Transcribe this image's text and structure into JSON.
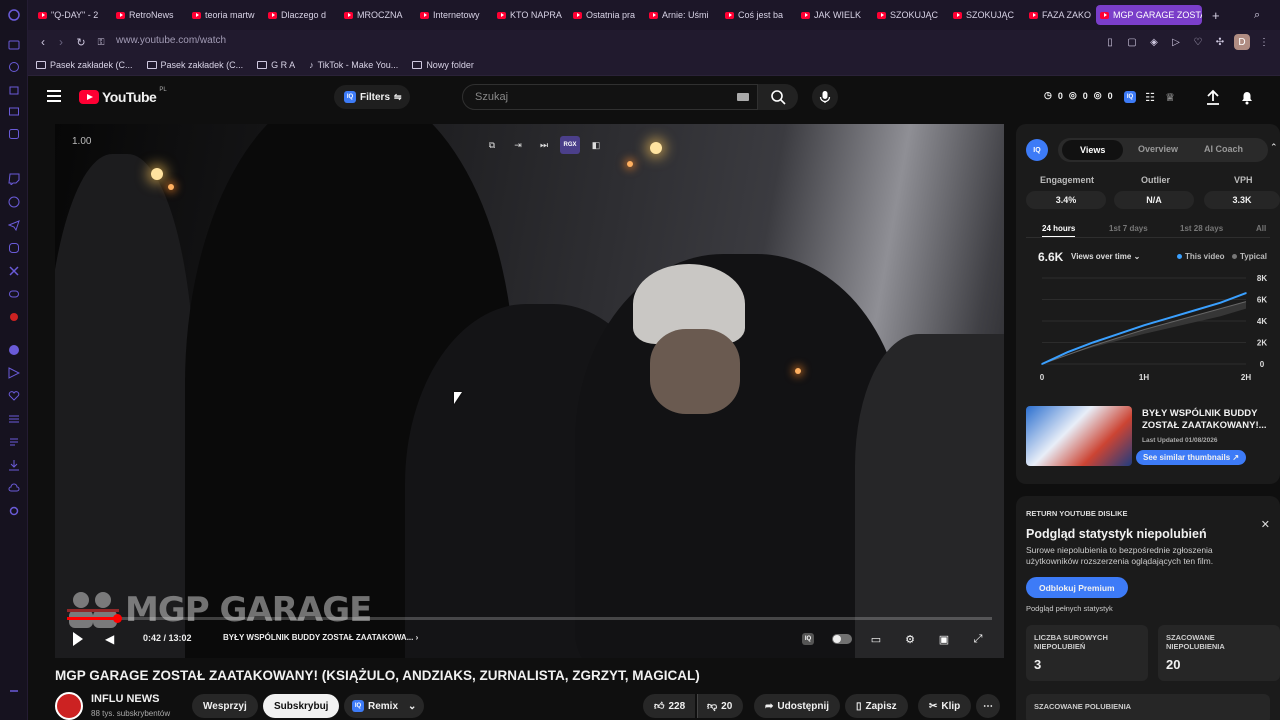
{
  "browser": {
    "tabs": [
      {
        "label": "\"Q-DAY\" - 2"
      },
      {
        "label": "RetroNews"
      },
      {
        "label": "teoria martw"
      },
      {
        "label": "Dlaczego d"
      },
      {
        "label": "MROCZNA"
      },
      {
        "label": "Internetowy"
      },
      {
        "label": "KTO NAPRA"
      },
      {
        "label": "Ostatnia pra"
      },
      {
        "label": "Arnie: Uśmi"
      },
      {
        "label": "Coś jest ba"
      },
      {
        "label": "JAK WIELK"
      },
      {
        "label": "SZOKUJĄC"
      },
      {
        "label": "SZOKUJĄC"
      },
      {
        "label": "FAZA ZAKO"
      },
      {
        "label": "MGP GARAGE ZOSTA"
      }
    ],
    "new_tab": "+",
    "url": "www.youtube.com/watch",
    "profile_initial": "D",
    "bookmarks": [
      {
        "label": "Pasek zakładek (C..."
      },
      {
        "label": "Pasek zakładek (C..."
      },
      {
        "label": "G R A"
      },
      {
        "label": "TikTok - Make You..."
      },
      {
        "label": "Nowy folder"
      }
    ]
  },
  "youtube": {
    "logo": "YouTube",
    "country": "PL",
    "filters_label": "Filters",
    "search_placeholder": "Szukaj",
    "header_stats": [
      "0",
      "0",
      "0"
    ]
  },
  "player": {
    "speed": "1.00",
    "rgx_label": "RGX",
    "watermark": "MGP GARAGE",
    "time": "0:42 / 13:02",
    "chapter": "BYŁY WSPÓLNIK BUDDY ZOSTAŁ ZAATAKOWA...",
    "progress_fraction": 0.054
  },
  "video": {
    "title": "MGP GARAGE ZOSTAŁ ZAATAKOWANY! (KSIĄŻULO, ANDZIAKS, ZURNALISTA, ZGRZYT, MAGICAL)",
    "channel": "INFLU NEWS",
    "subscribers": "88 tys. subskrybentów",
    "support": "Wesprzyj",
    "subscribe": "Subskrybuj",
    "remix": "Remix",
    "likes": "228",
    "dislikes": "20",
    "share": "Udostępnij",
    "save": "Zapisz",
    "clip": "Klip"
  },
  "vidiq": {
    "badge": "IQ",
    "tabs": [
      "Views",
      "Overview",
      "AI Coach"
    ],
    "metrics": [
      {
        "label": "Engagement",
        "value": "3.4%"
      },
      {
        "label": "Outlier",
        "value": "N/A"
      },
      {
        "label": "VPH",
        "value": "3.3K"
      }
    ],
    "ranges": [
      "24 hours",
      "1st 7 days",
      "1st 28 days",
      "All"
    ],
    "views": "6.6K",
    "views_over_time": "Views over time",
    "legend_this": "This video",
    "legend_typical": "Typical",
    "thumb_title": "BYŁY WSPÓLNIK BUDDY ZOSTAŁ ZAATAKOWANY!...",
    "thumb_updated": "Last Updated 01/08/2026",
    "thumb_button": "See similar thumbnails ↗",
    "colors": {
      "accent": "#3d7bf7",
      "line": "#3aa0ff"
    }
  },
  "chart_data": {
    "type": "line",
    "x": [
      "0",
      "1H",
      "2H"
    ],
    "yticks": [
      "8K",
      "6K",
      "4K",
      "2K",
      "0"
    ],
    "ylim": [
      0,
      8000
    ],
    "series": [
      {
        "name": "This video",
        "x": [
          0,
          0.25,
          0.5,
          0.75,
          1.0,
          1.25,
          1.5,
          1.75,
          2.0
        ],
        "values": [
          0,
          1100,
          2000,
          2800,
          3600,
          4300,
          5000,
          5700,
          6600
        ]
      },
      {
        "name": "Typical",
        "x": [
          0,
          0.5,
          1.0,
          1.5,
          2.0
        ],
        "values": [
          0,
          1700,
          3200,
          4500,
          5800
        ]
      }
    ]
  },
  "dislike": {
    "tag": "RETURN YOUTUBE DISLIKE",
    "title": "Podgląd statystyk niepolubień",
    "desc": "Surowe niepolubienia to bezpośrednie zgłoszenia użytkowników rozszerzenia oglądających ten film.",
    "button": "Odblokuj Premium",
    "note": "Podgląd pełnych statystyk",
    "cards": [
      {
        "label": "LICZBA SUROWYCH NIEPOLUBIEŃ",
        "value": "3"
      },
      {
        "label": "SZACOWANE NIEPOLUBIENIA",
        "value": "20"
      }
    ],
    "likes_card": "SZACOWANE POLUBIENIA"
  }
}
